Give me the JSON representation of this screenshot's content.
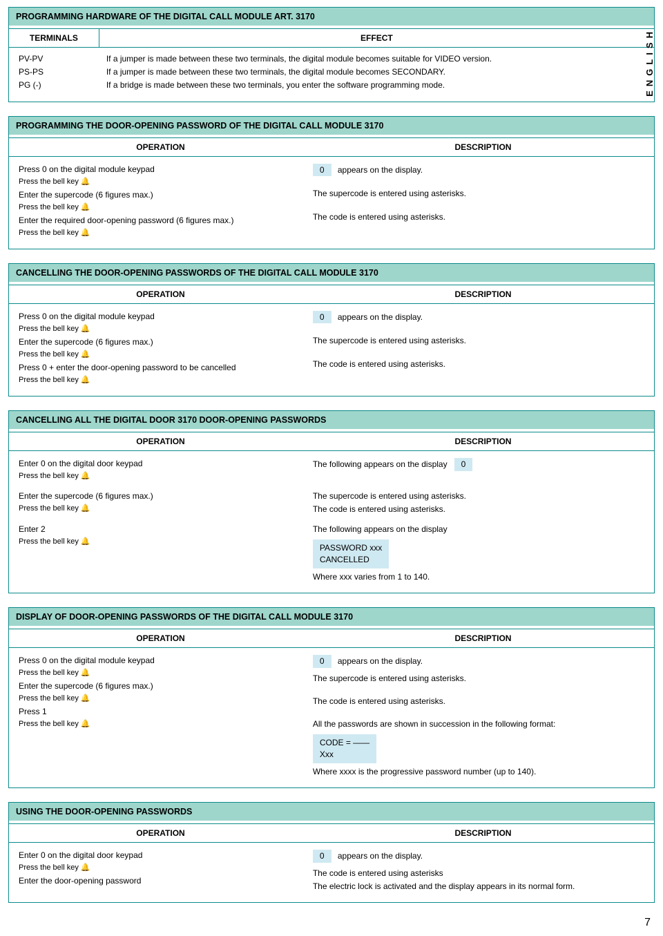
{
  "side_label": "ENGLISH",
  "page_number": "7",
  "chart_data": {
    "type": "table",
    "tables": [
      {
        "title": "PROGRAMMING HARDWARE OF THE DIGITAL CALL MODULE ART. 3170",
        "columns": [
          "TERMINALS",
          "EFFECT"
        ],
        "rows": [
          [
            "PV-PV",
            "If a jumper is made between these two terminals, the digital module  becomes suitable for VIDEO version."
          ],
          [
            "PS-PS",
            "If a jumper is made between these two terminals, the digital module becomes SECONDARY."
          ],
          [
            "PG (-)",
            "If a bridge is made between these two terminals, you enter the software programming mode."
          ]
        ]
      }
    ]
  },
  "s1": {
    "title": "PROGRAMMING HARDWARE OF THE DIGITAL CALL MODULE ART. 3170",
    "hdr_l": "TERMINALS",
    "hdr_r": "EFFECT",
    "t1": "PV-PV",
    "t2": "PS-PS",
    "t3": "PG (-)",
    "e1": "If a jumper is made between these two terminals, the digital module  becomes suitable for VIDEO version.",
    "e2": "If a jumper is made between these two terminals, the digital module becomes SECONDARY.",
    "e3": "If a bridge is made between these two terminals, you enter the software programming mode."
  },
  "common": {
    "op": "OPERATION",
    "desc": "DESCRIPTION",
    "bell": "Press the bell key 🔔",
    "zero": "0",
    "appears": "appears on the display.",
    "super_ast": "The supercode is entered using asterisks.",
    "code_ast": "The code is entered using asterisks."
  },
  "s2": {
    "title": "PROGRAMMING THE DOOR-OPENING PASSWORD OF THE DIGITAL CALL MODULE  3170",
    "l1": "Press 0 on the digital module keypad",
    "l3": "Enter the supercode (6 figures max.)",
    "l5": "Enter the required door-opening password (6 figures max.)"
  },
  "s3": {
    "title": "CANCELLING THE DOOR-OPENING PASSWORDS OF THE  DIGITAL CALL MODULE 3170",
    "l1": "Press 0 on the digital module keypad",
    "l3": "Enter the supercode (6 figures max.)",
    "l5": "Press 0 + enter the door-opening password to be cancelled"
  },
  "s4": {
    "title": "CANCELLING ALL THE DIGITAL DOOR 3170 DOOR-OPENING PASSWORDS",
    "l1": "Enter 0 on the digital door keypad",
    "l3": "Enter the supercode (6 figures max.)",
    "l5": "Enter 2",
    "r1": "The following appears on the display",
    "r3a": "The supercode is entered using asterisks.",
    "r3b": "The code is entered using asterisks.",
    "r5": "The following appears on the display",
    "box1": "PASSWORD   xxx",
    "box2": "CANCELLED",
    "r6": "Where xxx varies from 1 to 140."
  },
  "s5": {
    "title": "DISPLAY OF DOOR-OPENING PASSWORDS OF THE DIGITAL CALL MODULE 3170",
    "l1": "Press 0 on the digital module keypad",
    "l3": "Enter the supercode (6 figures max.)",
    "l5": "Press 1",
    "r4": "All the passwords are shown in succession in the following format:",
    "box1": "CODE  =  ——",
    "box2": "Xxx",
    "r5": "Where xxxx is the progressive password number (up to 140)."
  },
  "s6": {
    "title": "USING THE DOOR-OPENING PASSWORDS",
    "l1": "Enter 0 on the digital door keypad",
    "l3": "Enter the door-opening password",
    "r2": "The code is entered using asterisks",
    "r3": "The electric lock is activated and the display appears in its normal form."
  }
}
